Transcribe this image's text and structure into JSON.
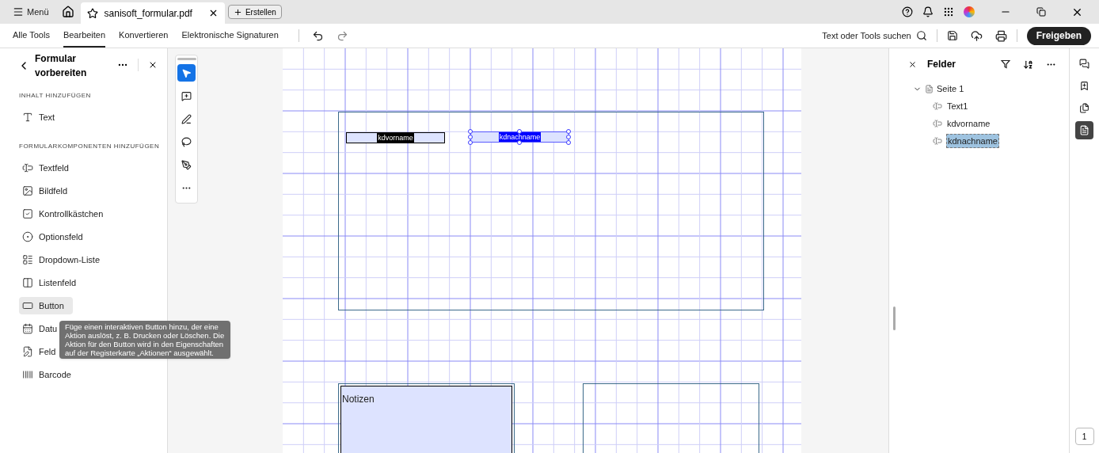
{
  "title_bar": {
    "menu": "Menü",
    "document_tab": {
      "title": "sanisoft_formular.pdf",
      "starred": false
    },
    "create_button": "Erstellen"
  },
  "toolbar": {
    "tabs": [
      {
        "label": "Alle Tools",
        "selected": false
      },
      {
        "label": "Bearbeiten",
        "selected": true
      },
      {
        "label": "Konvertieren",
        "selected": false
      },
      {
        "label": "Elektronische Signaturen",
        "selected": false
      }
    ],
    "search": "Text oder Tools suchen",
    "share_button": "Freigeben"
  },
  "left_panel": {
    "title": "Formular vorbereiten",
    "sections": [
      {
        "heading": "INHALT HINZUFÜGEN",
        "items": [
          {
            "kind": "text",
            "label": "Text",
            "selected": false
          }
        ]
      },
      {
        "heading": "FORMULARKOMPONENTEN HINZUFÜGEN",
        "items": [
          {
            "kind": "textfield",
            "label": "Textfeld",
            "selected": false
          },
          {
            "kind": "image",
            "label": "Bildfeld",
            "selected": false
          },
          {
            "kind": "checkbox",
            "label": "Kontrollkästchen",
            "selected": false
          },
          {
            "kind": "radio",
            "label": "Optionsfeld",
            "selected": false
          },
          {
            "kind": "dropdown",
            "label": "Dropdown-Liste",
            "selected": false
          },
          {
            "kind": "list",
            "label": "Listenfeld",
            "selected": false
          },
          {
            "kind": "button",
            "label": "Button",
            "selected": true
          },
          {
            "kind": "date",
            "label": "Datu",
            "selected": false
          },
          {
            "kind": "signature",
            "label": "Feld",
            "selected": false
          },
          {
            "kind": "barcode",
            "label": "Barcode",
            "selected": false
          }
        ]
      }
    ],
    "tooltip": "Füge einen interaktiven Button hinzu, der eine Aktion auslöst, z. B. Drucken oder Löschen. Die Aktion für den Button wird in den Eigenschaften auf der Registerkarte „Aktionen“ ausgewählt."
  },
  "tools": [
    {
      "kind": "select",
      "selected": true
    },
    {
      "kind": "comment",
      "selected": false
    },
    {
      "kind": "draw",
      "selected": false
    },
    {
      "kind": "lasso",
      "selected": false
    },
    {
      "kind": "sign",
      "selected": false
    },
    {
      "kind": "more",
      "selected": false
    }
  ],
  "document": {
    "fields": [
      {
        "name": "kdvorname",
        "selected": false
      },
      {
        "name": "kdnachname",
        "selected": true
      }
    ],
    "notes_label": "Notizen"
  },
  "fields_panel": {
    "title": "Felder",
    "tree": [
      {
        "label": "Seite 1",
        "expanded": true,
        "children": [
          {
            "label": "Text1",
            "selected": false
          },
          {
            "label": "kdvorname",
            "selected": false
          },
          {
            "label": "kdnachname",
            "selected": true
          }
        ]
      }
    ]
  },
  "side_icons": [
    {
      "kind": "comments",
      "selected": false
    },
    {
      "kind": "bookmarks",
      "selected": false
    },
    {
      "kind": "pages",
      "selected": false
    },
    {
      "kind": "fields",
      "selected": true
    }
  ],
  "page_number": "1"
}
